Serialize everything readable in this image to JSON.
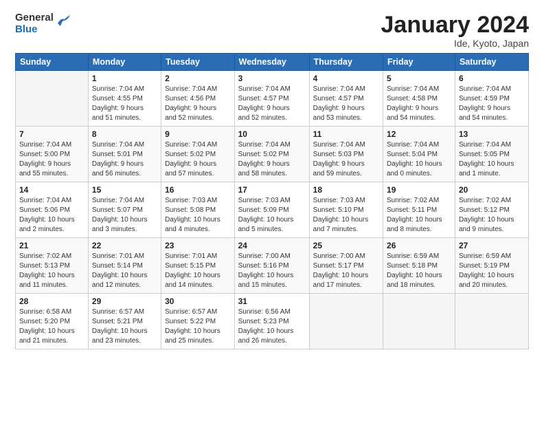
{
  "header": {
    "logo_line1": "General",
    "logo_line2": "Blue",
    "month_title": "January 2024",
    "subtitle": "Ide, Kyoto, Japan"
  },
  "weekdays": [
    "Sunday",
    "Monday",
    "Tuesday",
    "Wednesday",
    "Thursday",
    "Friday",
    "Saturday"
  ],
  "weeks": [
    [
      {
        "day": "",
        "info": ""
      },
      {
        "day": "1",
        "info": "Sunrise: 7:04 AM\nSunset: 4:55 PM\nDaylight: 9 hours\nand 51 minutes."
      },
      {
        "day": "2",
        "info": "Sunrise: 7:04 AM\nSunset: 4:56 PM\nDaylight: 9 hours\nand 52 minutes."
      },
      {
        "day": "3",
        "info": "Sunrise: 7:04 AM\nSunset: 4:57 PM\nDaylight: 9 hours\nand 52 minutes."
      },
      {
        "day": "4",
        "info": "Sunrise: 7:04 AM\nSunset: 4:57 PM\nDaylight: 9 hours\nand 53 minutes."
      },
      {
        "day": "5",
        "info": "Sunrise: 7:04 AM\nSunset: 4:58 PM\nDaylight: 9 hours\nand 54 minutes."
      },
      {
        "day": "6",
        "info": "Sunrise: 7:04 AM\nSunset: 4:59 PM\nDaylight: 9 hours\nand 54 minutes."
      }
    ],
    [
      {
        "day": "7",
        "info": "Sunrise: 7:04 AM\nSunset: 5:00 PM\nDaylight: 9 hours\nand 55 minutes."
      },
      {
        "day": "8",
        "info": "Sunrise: 7:04 AM\nSunset: 5:01 PM\nDaylight: 9 hours\nand 56 minutes."
      },
      {
        "day": "9",
        "info": "Sunrise: 7:04 AM\nSunset: 5:02 PM\nDaylight: 9 hours\nand 57 minutes."
      },
      {
        "day": "10",
        "info": "Sunrise: 7:04 AM\nSunset: 5:02 PM\nDaylight: 9 hours\nand 58 minutes."
      },
      {
        "day": "11",
        "info": "Sunrise: 7:04 AM\nSunset: 5:03 PM\nDaylight: 9 hours\nand 59 minutes."
      },
      {
        "day": "12",
        "info": "Sunrise: 7:04 AM\nSunset: 5:04 PM\nDaylight: 10 hours\nand 0 minutes."
      },
      {
        "day": "13",
        "info": "Sunrise: 7:04 AM\nSunset: 5:05 PM\nDaylight: 10 hours\nand 1 minute."
      }
    ],
    [
      {
        "day": "14",
        "info": "Sunrise: 7:04 AM\nSunset: 5:06 PM\nDaylight: 10 hours\nand 2 minutes."
      },
      {
        "day": "15",
        "info": "Sunrise: 7:04 AM\nSunset: 5:07 PM\nDaylight: 10 hours\nand 3 minutes."
      },
      {
        "day": "16",
        "info": "Sunrise: 7:03 AM\nSunset: 5:08 PM\nDaylight: 10 hours\nand 4 minutes."
      },
      {
        "day": "17",
        "info": "Sunrise: 7:03 AM\nSunset: 5:09 PM\nDaylight: 10 hours\nand 5 minutes."
      },
      {
        "day": "18",
        "info": "Sunrise: 7:03 AM\nSunset: 5:10 PM\nDaylight: 10 hours\nand 7 minutes."
      },
      {
        "day": "19",
        "info": "Sunrise: 7:02 AM\nSunset: 5:11 PM\nDaylight: 10 hours\nand 8 minutes."
      },
      {
        "day": "20",
        "info": "Sunrise: 7:02 AM\nSunset: 5:12 PM\nDaylight: 10 hours\nand 9 minutes."
      }
    ],
    [
      {
        "day": "21",
        "info": "Sunrise: 7:02 AM\nSunset: 5:13 PM\nDaylight: 10 hours\nand 11 minutes."
      },
      {
        "day": "22",
        "info": "Sunrise: 7:01 AM\nSunset: 5:14 PM\nDaylight: 10 hours\nand 12 minutes."
      },
      {
        "day": "23",
        "info": "Sunrise: 7:01 AM\nSunset: 5:15 PM\nDaylight: 10 hours\nand 14 minutes."
      },
      {
        "day": "24",
        "info": "Sunrise: 7:00 AM\nSunset: 5:16 PM\nDaylight: 10 hours\nand 15 minutes."
      },
      {
        "day": "25",
        "info": "Sunrise: 7:00 AM\nSunset: 5:17 PM\nDaylight: 10 hours\nand 17 minutes."
      },
      {
        "day": "26",
        "info": "Sunrise: 6:59 AM\nSunset: 5:18 PM\nDaylight: 10 hours\nand 18 minutes."
      },
      {
        "day": "27",
        "info": "Sunrise: 6:59 AM\nSunset: 5:19 PM\nDaylight: 10 hours\nand 20 minutes."
      }
    ],
    [
      {
        "day": "28",
        "info": "Sunrise: 6:58 AM\nSunset: 5:20 PM\nDaylight: 10 hours\nand 21 minutes."
      },
      {
        "day": "29",
        "info": "Sunrise: 6:57 AM\nSunset: 5:21 PM\nDaylight: 10 hours\nand 23 minutes."
      },
      {
        "day": "30",
        "info": "Sunrise: 6:57 AM\nSunset: 5:22 PM\nDaylight: 10 hours\nand 25 minutes."
      },
      {
        "day": "31",
        "info": "Sunrise: 6:56 AM\nSunset: 5:23 PM\nDaylight: 10 hours\nand 26 minutes."
      },
      {
        "day": "",
        "info": ""
      },
      {
        "day": "",
        "info": ""
      },
      {
        "day": "",
        "info": ""
      }
    ]
  ]
}
